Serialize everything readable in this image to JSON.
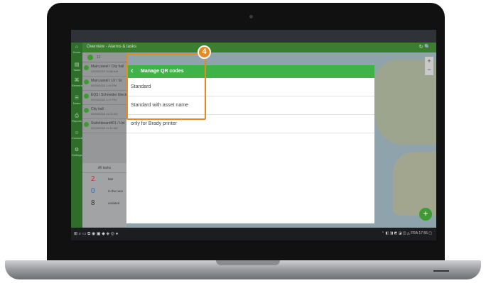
{
  "app": {
    "topbar_title": "Overview - Alarms & tasks",
    "topbar_icons": "↻ 🔍"
  },
  "sidebar": {
    "items": [
      {
        "label": "Home",
        "icon": "home-icon",
        "glyph": "⌂"
      },
      {
        "label": "Tasks",
        "icon": "tasks-icon",
        "glyph": "▤"
      },
      {
        "label": "Elements",
        "icon": "elements-icon",
        "glyph": "⌘"
      },
      {
        "label": "Notes",
        "icon": "notes-icon",
        "glyph": "☰"
      },
      {
        "label": "Reports",
        "icon": "reports-icon",
        "glyph": "⎙"
      },
      {
        "label": "Contacts",
        "icon": "contacts-icon",
        "glyph": "☺"
      },
      {
        "label": "Settings",
        "icon": "settings-icon",
        "glyph": "⚙"
      }
    ]
  },
  "list": {
    "tab_count": "12",
    "rows": [
      {
        "title": "Main panel / City hall",
        "date": "12/09/2020 10:56 AM"
      },
      {
        "title": "Main panel / LV / St",
        "date": "09/29/2020 1:41 PM"
      },
      {
        "title": "EQ3 / Schneider Electric",
        "date": "09/29/2020 1:47 PM"
      },
      {
        "title": "City hall",
        "date": "09/29/2020 11:22 AM"
      },
      {
        "title": "Switchboard401 / Uni",
        "date": "09/29/2020 11:11 AM"
      }
    ]
  },
  "stats": {
    "header": "All tasks",
    "items": [
      {
        "value": "2",
        "label": "late",
        "color": "#c4342d"
      },
      {
        "value": "0",
        "label": "in the next",
        "color": "#2f6fb3"
      },
      {
        "value": "8",
        "label": "undated",
        "color": "#333333"
      }
    ]
  },
  "map": {
    "zoom_in": "+",
    "zoom_out": "−",
    "fab": "+"
  },
  "modal": {
    "title": "Manage QR codes",
    "options": [
      "Standard",
      "Standard with asset name",
      "only for Brady printer"
    ]
  },
  "callout": {
    "number": "4",
    "color": "#e68a1f"
  },
  "taskbar": {
    "left": "⊞ ⌕ ▭ ⧉ ◉ ▣ ◆ ◈ ◎ ●",
    "right": "⌃ ◧ ◨ ◩ ◪ ◫ ◬ FRA 17:56 ▢"
  },
  "colors": {
    "accent_green": "#3fb24a",
    "dark_green": "#2e6e2a"
  }
}
